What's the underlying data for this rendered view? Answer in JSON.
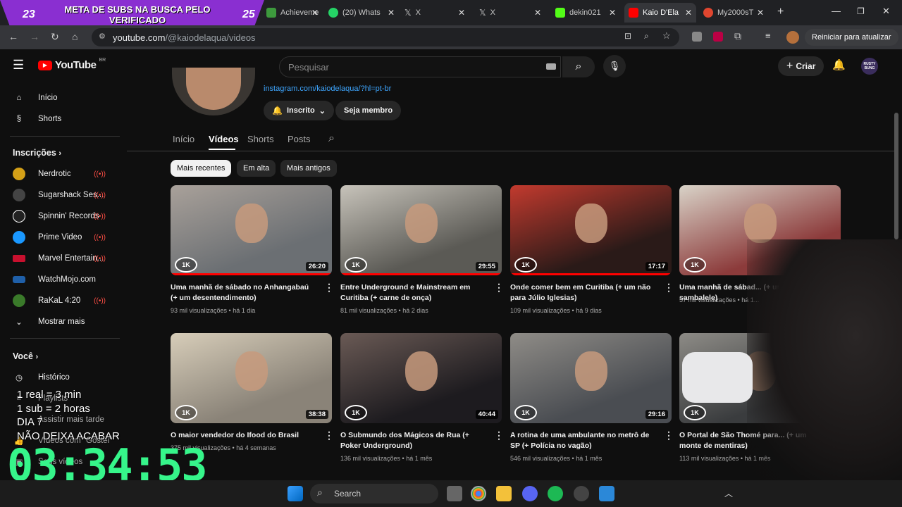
{
  "browser": {
    "tabs": [
      {
        "label": "Achieveme"
      },
      {
        "label": "(20) Whats"
      },
      {
        "label": "X"
      },
      {
        "label": "X"
      },
      {
        "label": "dekin021"
      },
      {
        "label": "Kaio D'Ela"
      },
      {
        "label": "My2000sT"
      }
    ],
    "url_host": "youtube.com",
    "url_path": "/@kaiodelaqua/videos",
    "update_label": "Reiniciar para atualizar"
  },
  "overlay": {
    "banner_text": "META DE SUBS NA BUSCA PELO VERIFICADO",
    "banner_left": "23",
    "banner_right": "25",
    "rules": [
      "1 real = 3 min",
      "1 sub = 2 horas",
      "DIA 7",
      "NÃO DEIXA ACABAR"
    ],
    "timer": "03:34:53"
  },
  "youtube": {
    "logo": "YouTube",
    "country": "BR",
    "search_placeholder": "Pesquisar",
    "create_label": "Criar",
    "avatar_text": "RUSTY BUNG"
  },
  "sidebar": {
    "items": [
      {
        "label": "Início",
        "icon": "home-icon"
      },
      {
        "label": "Shorts",
        "icon": "shorts-icon"
      }
    ],
    "subs_title": "Inscrições",
    "subs": [
      {
        "label": "Nerdrotic",
        "color": "#d4a017"
      },
      {
        "label": "Sugarshack Ses...",
        "color": "#444444"
      },
      {
        "label": "Spinnin' Records",
        "color": "#222222"
      },
      {
        "label": "Prime Video",
        "color": "#1a98ff"
      },
      {
        "label": "Marvel Entertain...",
        "color": "#c8102e"
      },
      {
        "label": "WatchMojo.com",
        "color": "#1f5fa8"
      },
      {
        "label": "RaKaL 4:20",
        "color": "#3a7a2a"
      }
    ],
    "show_more": "Mostrar mais",
    "you_title": "Você",
    "you_items": [
      "Histórico",
      "Playlists",
      "Assistir mais tarde",
      "Vídeos com \"Gostei\"",
      "Seus vídeos"
    ]
  },
  "channel": {
    "link": "instagram.com/kaiodelaqua/?hl=pt-br",
    "subscribed_label": "Inscrito",
    "member_label": "Seja membro",
    "tabs": [
      "Início",
      "Vídeos",
      "Shorts",
      "Posts"
    ],
    "active_tab": "Vídeos",
    "chips": [
      "Mais recentes",
      "Em alta",
      "Mais antigos"
    ],
    "badge": "1K"
  },
  "videos": [
    {
      "title": "Uma manhã de sábado no Anhangabaú (+ um desentendimento)",
      "views": "93 mil visualizações",
      "age": "há 1 dia",
      "duration": "26:20",
      "colors": [
        "#6b6f73",
        "#a9a19a"
      ]
    },
    {
      "title": "Entre Underground e Mainstream em Curitiba (+ carne de onça)",
      "views": "81 mil visualizações",
      "age": "há 2 dias",
      "duration": "29:55",
      "colors": [
        "#5b5a55",
        "#c7c3ba"
      ]
    },
    {
      "title": "Onde comer bem em Curitiba (+ um não para Júlio Iglesias)",
      "views": "109 mil visualizações",
      "age": "há 9 dias",
      "duration": "17:17",
      "colors": [
        "#2a1a18",
        "#c23a2e"
      ]
    },
    {
      "title": "Uma manhã de sábad... (+ um sambalele)",
      "views": "57 mil visualizações",
      "age": "há 1...",
      "duration": "",
      "colors": [
        "#8c3b3b",
        "#d9d3c8"
      ]
    },
    {
      "title": "O maior vendedor do Ifood do Brasil",
      "views": "375 mil visualizações",
      "age": "há 4 semanas",
      "duration": "38:38",
      "colors": [
        "#8a8378",
        "#d7cdb9"
      ]
    },
    {
      "title": "O Submundo dos Mágicos de Rua (+ Poker Underground)",
      "views": "136 mil visualizações",
      "age": "há 1 mês",
      "duration": "40:44",
      "colors": [
        "#1d1b1f",
        "#6a5a55"
      ]
    },
    {
      "title": "A rotina de uma ambulante no metrô de SP (+ Polícia no vagão)",
      "views": "546 mil visualizações",
      "age": "há 1 mês",
      "duration": "29:16",
      "colors": [
        "#4a4d52",
        "#8f8c87"
      ]
    },
    {
      "title": "O Portal de São Thomé para... (+ um monte de mentiras)",
      "views": "113 mil visualizações",
      "age": "há 1 mês",
      "duration": "",
      "colors": [
        "#3a3c3e",
        "#8d8b86"
      ]
    }
  ],
  "taskbar": {
    "search_label": "Search"
  }
}
